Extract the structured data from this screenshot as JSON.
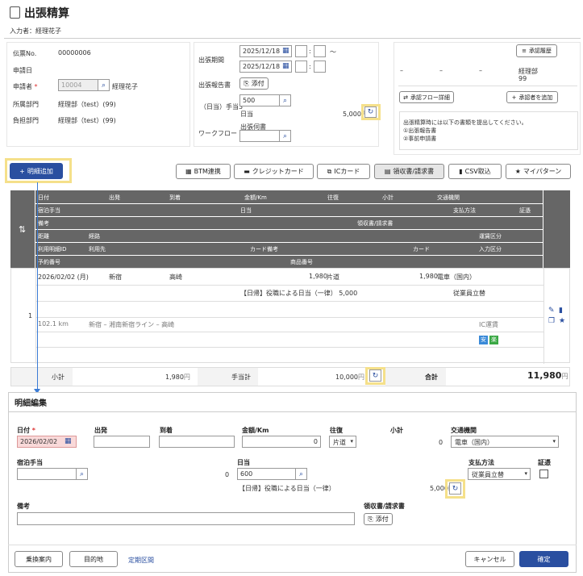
{
  "header": {
    "title": "出張精算",
    "applicant_label": "入力者：",
    "applicant": "経理花子"
  },
  "form": {
    "slip_no_label": "伝票No.",
    "slip_no": "00000006",
    "apply_date_label": "申請日",
    "applicant_label": "申請者",
    "required": "*",
    "applicant_code": "10004",
    "applicant_name": "経理花子",
    "dept_label": "所属部門",
    "dept": "経理部（test）(99)",
    "burden_label": "負担部門",
    "burden": "経理部（test）(99)",
    "trip_period_label": "出張期間",
    "date_from": "2025/12/18",
    "date_to": "2025/12/18",
    "time_sep": ":",
    "tilde": "～",
    "trip_report_label": "出張報告書",
    "attach": "添付",
    "allowance_label": "（日当）手当3",
    "allowance_input": "500",
    "daily_label": "日当",
    "daily_value": "5,000",
    "workflow_label": "ワークフロー",
    "business_trip_label": "出張伺書"
  },
  "approval": {
    "history_button": "承認履歴",
    "cols": [
      "–",
      "–",
      "–"
    ],
    "approver_dept": "経理部",
    "approver_code": "99",
    "flow_detail_button": "承認フロー詳細",
    "add_approver_button": "承認者を追加",
    "notice": [
      "出張精算時には以下の書類を提出してください。",
      "①出張報告書",
      "②事前申請書"
    ]
  },
  "toolbar": {
    "add_detail": "明細追加",
    "btm": "BTM連携",
    "credit": "クレジットカード",
    "ic": "ICカード",
    "receipt": "領収書/請求書",
    "csv": "CSV取込",
    "mypattern": "マイパターン"
  },
  "grid_headers": {
    "row1": [
      "日付",
      "出発",
      "到着",
      "金額/Km",
      "往復",
      "小計",
      "交通機関"
    ],
    "row2": [
      "宿泊手当",
      "日当",
      "支払方法",
      "証憑"
    ],
    "row3": [
      "備考",
      "領収書/請求書"
    ],
    "row4": [
      "距離",
      "経路",
      "運賃区分"
    ],
    "row5": [
      "利用明細ID",
      "利用先",
      "カード備考",
      "カード",
      "入力区分"
    ],
    "row6": [
      "予約番号",
      "商品番号"
    ]
  },
  "grid_row": {
    "no": "1",
    "date": "2026/02/02 (月)",
    "from": "新宿",
    "to": "高崎",
    "amount": "1,980",
    "trip": "片道",
    "subtotal": "1,980",
    "transport": "電車（国内）",
    "daily_text": "【日帰】役職による日当（一律） 5,000",
    "payment": "従業員立替",
    "distance": "102.1 km",
    "route": "新宿 – 湘南新宿ライン – 高崎",
    "fare_type": "IC運賃",
    "badge1": "安",
    "badge2": "楽"
  },
  "totals": {
    "subtotal_label": "小計",
    "subtotal": "1,980",
    "yen": "円",
    "allowance_label": "手当計",
    "allowance": "10,000",
    "total_label": "合計",
    "total": "11,980"
  },
  "editor": {
    "title": "明細編集",
    "date_label": "日付",
    "required": "*",
    "date_value": "2026/02/02",
    "from_label": "出発",
    "to_label": "到着",
    "amount_label": "金額/Km",
    "amount_value": "0",
    "trip_label": "往復",
    "trip_value": "片道",
    "subtotal_label": "小計",
    "subtotal_value": "0",
    "transport_label": "交通機関",
    "transport_value": "電車（国内）",
    "lodging_label": "宿泊手当",
    "lodging_sub": "0",
    "daily_label": "日当",
    "daily_input": "600",
    "daily_text": "【日帰】役職による日当（一律）",
    "daily_value": "5,000",
    "payment_label": "支払方法",
    "payment_value": "従業員立替",
    "voucher_label": "証憑",
    "memo_label": "備考",
    "receipt_label": "領収書/請求書",
    "attach": "添付"
  },
  "footer": {
    "transfer": "乗換案内",
    "destination": "目的地",
    "commuter": "定期区間",
    "cancel": "キャンセル",
    "confirm": "確定"
  },
  "colors": {
    "primary": "#2a4fa0",
    "grid_header": "#666666",
    "highlight": "#f5e08a",
    "badge_blue": "#3a8ad8",
    "badge_green": "#3aa844",
    "date_error": "#f9d9d9"
  }
}
